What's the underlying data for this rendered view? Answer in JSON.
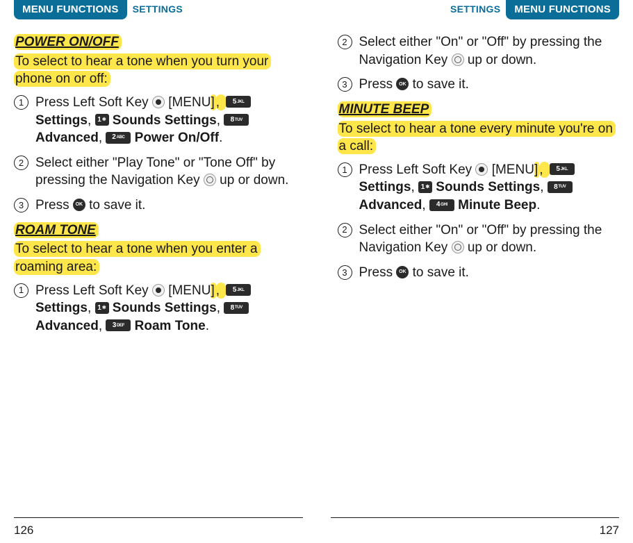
{
  "header": {
    "tab": "MENU FUNCTIONS",
    "crumb": "SETTINGS"
  },
  "pages": {
    "left": "126",
    "right": "127"
  },
  "keys": {
    "menu_bracket_open": "[",
    "menu_bracket_close": "]",
    "menu_word": "MENU",
    "ok": "OK",
    "k5_num": "5",
    "k5_txt": "JKL",
    "k1_num": "1",
    "k1_sym": "✱",
    "k8_num": "8",
    "k8_txt": "TUV",
    "k2_num": "2",
    "k2_txt": "ABC",
    "k3_num": "3",
    "k3_txt": "DEF",
    "k4_num": "4",
    "k4_txt": "GHI"
  },
  "labels": {
    "settings": "Settings",
    "sounds_settings": "Sounds Settings",
    "advanced": "Advanced",
    "power_on_off_opt": "Power On/Off",
    "roam_tone_opt": "Roam Tone",
    "minute_beep_opt": "Minute Beep"
  },
  "left": {
    "power": {
      "title": "POWER ON/OFF",
      "desc": "To select to hear a tone when you turn your phone on or off:",
      "step1_a": "Press Left Soft Key ",
      "step1_comma": ", ",
      "step2": "Select either \"Play Tone\" or \"Tone Off\" by pressing the Navigation Key ",
      "step2_b": " up or down.",
      "step3_a": "Press ",
      "step3_b": " to save it."
    },
    "roam": {
      "title": "ROAM TONE",
      "desc": "To select to hear a tone when you enter a roaming area:",
      "step1_a": "Press Left Soft Key ",
      "step1_comma": ", "
    }
  },
  "right": {
    "cont": {
      "step2_a": "Select either \"On\" or \"Off\" by pressing the Navigation Key ",
      "step2_b": " up or down.",
      "step3_a": "Press ",
      "step3_b": " to save it."
    },
    "minute": {
      "title": "MINUTE BEEP",
      "desc": "To select to hear a tone every minute you're on a call:",
      "step1_a": "Press Left Soft Key ",
      "step1_comma": ", ",
      "step2_a": "Select either \"On\" or \"Off\" by pressing the Navigation Key ",
      "step2_b": " up or down.",
      "step3_a": "Press ",
      "step3_b": " to save it."
    }
  }
}
